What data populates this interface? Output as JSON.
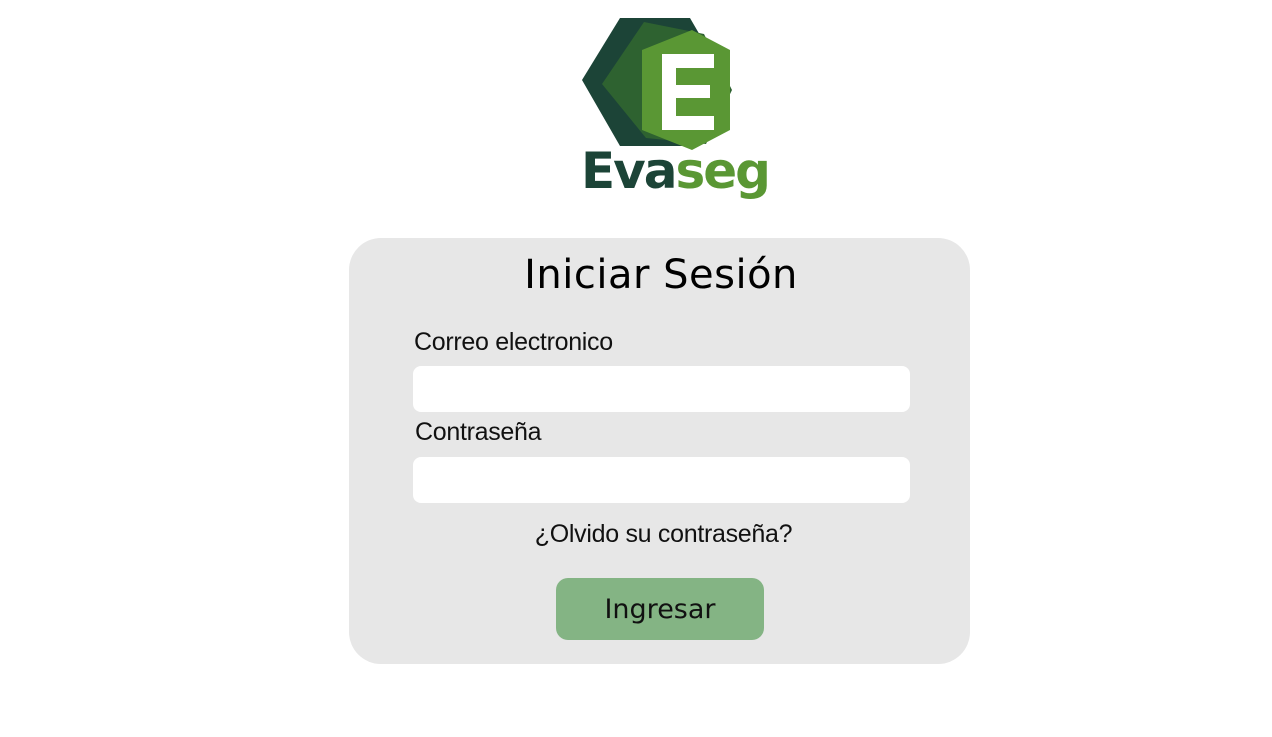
{
  "brand": {
    "name_part1": "Eva",
    "name_part2": "seg",
    "logo_letter": "E",
    "colors": {
      "dark": "#1c4437",
      "mid": "#2e6230",
      "light": "#5a9734"
    }
  },
  "login": {
    "title": "Iniciar Sesión",
    "email_label": "Correo electronico",
    "email_value": "",
    "password_label": "Contraseña",
    "password_value": "",
    "forgot_link": "¿Olvido su contraseña?",
    "submit_label": "Ingresar",
    "button_color": "#84b484",
    "card_color": "#e7e7e7"
  }
}
